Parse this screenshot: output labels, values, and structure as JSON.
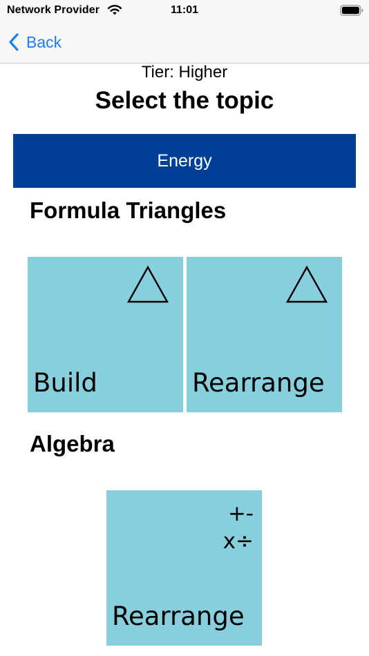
{
  "status_bar": {
    "carrier": "Network Provider",
    "time": "11:01",
    "wifi_icon": "wifi-icon",
    "battery_icon": "battery-icon"
  },
  "nav": {
    "back_label": "Back",
    "back_icon": "chevron-left-icon"
  },
  "header": {
    "tier": "Tier: Higher",
    "title": "Select the topic"
  },
  "subject": {
    "label": "Energy",
    "color": "#003f96"
  },
  "sections": {
    "formula_triangles": {
      "heading": "Formula Triangles",
      "tiles": {
        "build": {
          "label": "Build",
          "icon": "triangle-icon"
        },
        "rearrange": {
          "label": "Rearrange",
          "icon": "triangle-icon"
        }
      }
    },
    "algebra": {
      "heading": "Algebra",
      "tiles": {
        "rearrange": {
          "label": "Rearrange",
          "icon": "operators-icon",
          "ops_line1": "+-",
          "ops_line2": "x÷"
        }
      }
    }
  },
  "colors": {
    "tile": "#87cfdc",
    "accent": "#1a7ff6",
    "banner": "#003f96"
  }
}
